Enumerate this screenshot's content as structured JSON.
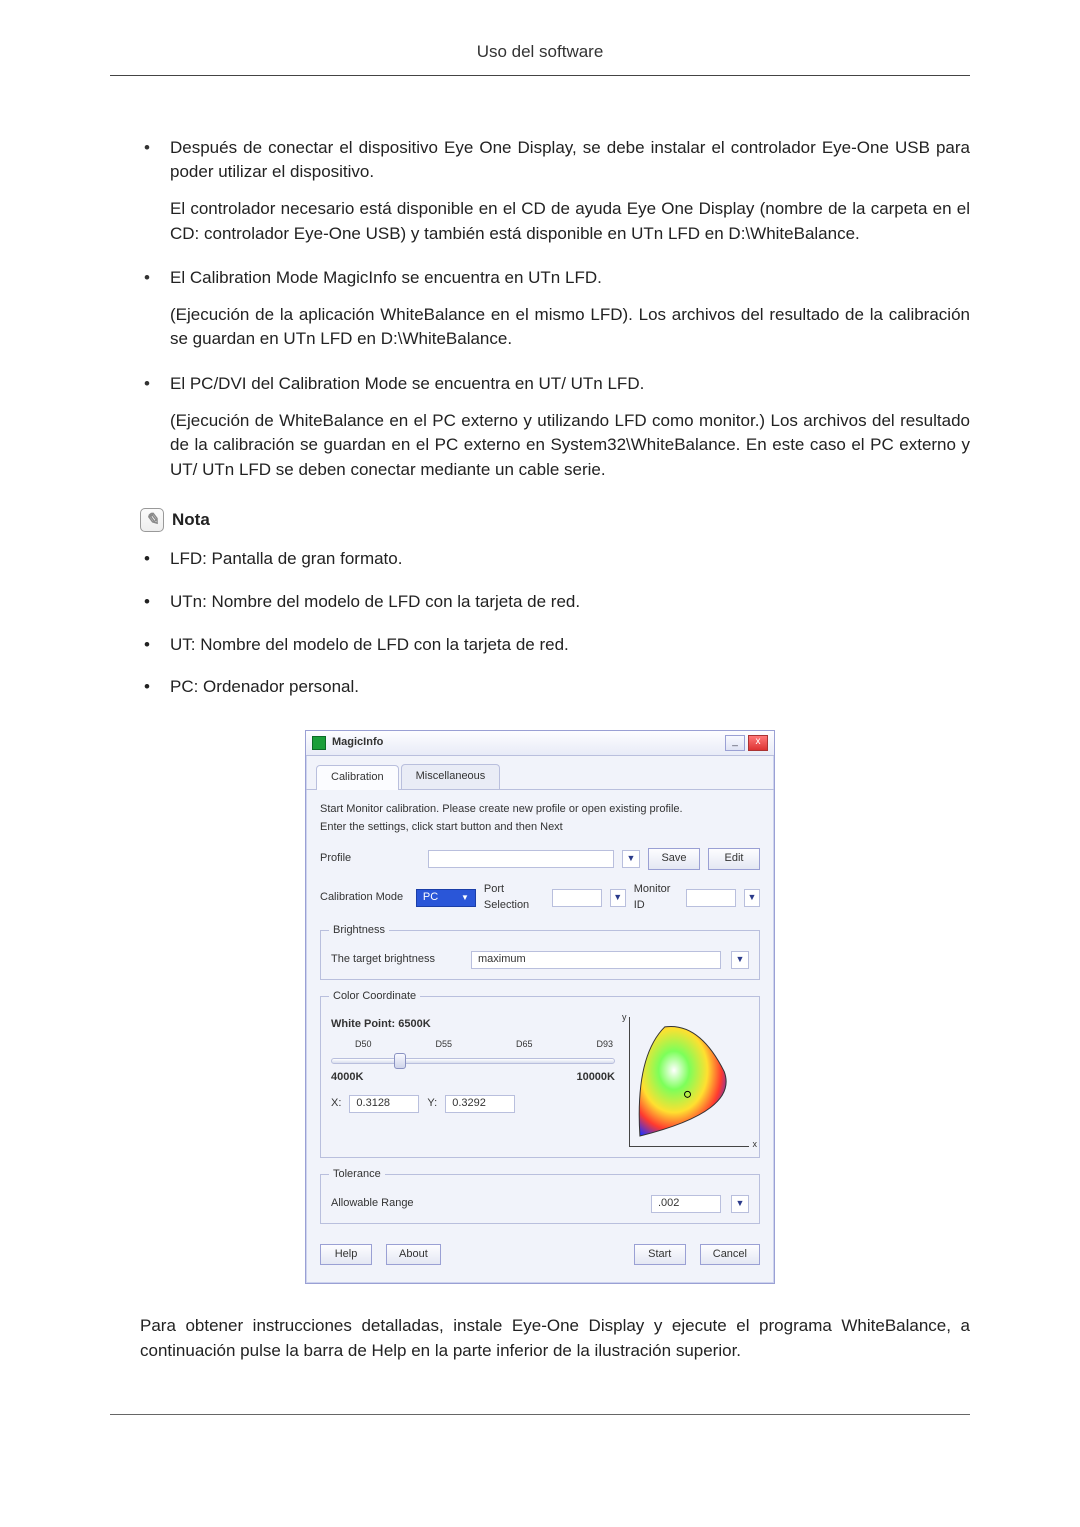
{
  "header": {
    "title": "Uso del software"
  },
  "content": {
    "bullets": [
      {
        "text": "Después de conectar el dispositivo Eye One Display, se debe instalar el controlador Eye-One USB para poder utilizar el dispositivo.",
        "sub": "El controlador necesario está disponible en el CD de ayuda Eye One Display (nombre de la carpeta en el CD: controlador Eye-One USB) y también está disponible en UTn LFD en D:\\WhiteBalance."
      },
      {
        "text": "El Calibration Mode MagicInfo se encuentra en UTn LFD.",
        "sub": "(Ejecución de la aplicación WhiteBalance en el mismo LFD). Los archivos del resultado de la calibración se guardan en UTn LFD en D:\\WhiteBalance."
      },
      {
        "text": "El PC/DVI del Calibration Mode se encuentra en UT/ UTn LFD.",
        "sub": "(Ejecución de WhiteBalance en el PC externo y utilizando LFD como monitor.) Los archivos del resultado de la calibración se guardan en el PC externo en System32\\WhiteBalance. En este caso el PC externo y UT/ UTn LFD se deben conectar mediante un cable serie."
      }
    ],
    "nota_label": "Nota",
    "note_bullets": [
      "LFD: Pantalla de gran formato.",
      "UTn: Nombre del modelo de LFD con la tarjeta de red.",
      "UT: Nombre del modelo de LFD con la tarjeta de red.",
      "PC: Ordenador personal."
    ],
    "closing": "Para obtener instrucciones detalladas, instale Eye-One Display y ejecute el programa WhiteBalance, a continuación pulse la barra de Help en la parte inferior de la ilustración superior."
  },
  "dialog": {
    "title": "MagicInfo",
    "tabs": {
      "calibration": "Calibration",
      "misc": "Miscellaneous"
    },
    "instructions": {
      "line1": "Start Monitor calibration. Please create new profile or open existing profile.",
      "line2": "Enter the settings, click start button and then Next"
    },
    "profile": {
      "label": "Profile",
      "value": "",
      "save": "Save",
      "edit": "Edit"
    },
    "calmode": {
      "label": "Calibration Mode",
      "value": "PC",
      "port_label": "Port Selection",
      "port_value": "",
      "monid_label": "Monitor ID",
      "monid_value": ""
    },
    "brightness": {
      "group": "Brightness",
      "label": "The target brightness",
      "value": "maximum"
    },
    "color": {
      "group": "Color Coordinate",
      "white_point_label": "White Point:",
      "white_point_value": "6500K",
      "scale": {
        "d50": "D50",
        "d55": "D55",
        "d65": "D65",
        "d93": "D93"
      },
      "range_low": "4000K",
      "range_high": "10000K",
      "x_label": "X:",
      "x_value": "0.3128",
      "y_label": "Y:",
      "y_value": "0.3292",
      "axis_y": "y",
      "axis_x": "x"
    },
    "tolerance": {
      "group": "Tolerance",
      "label": "Allowable Range",
      "value": ".002"
    },
    "buttons": {
      "help": "Help",
      "about": "About",
      "start": "Start",
      "cancel": "Cancel"
    },
    "window_controls": {
      "min": "_",
      "close": "x"
    }
  }
}
